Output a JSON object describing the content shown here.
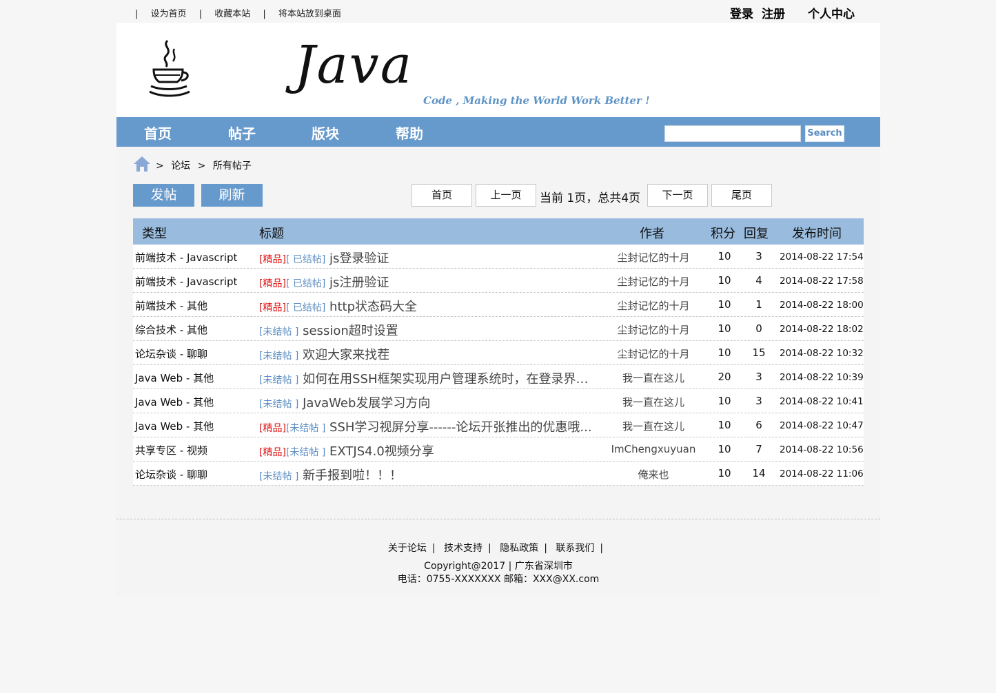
{
  "topbar": {
    "links": [
      "设为首页",
      "收藏本站",
      "将本站放到桌面"
    ],
    "separator": "|",
    "login": "登录",
    "register": "注册",
    "profile": "个人中心"
  },
  "banner": {
    "logo_text": "Java",
    "slogan": "Code , Making the World Work Better !"
  },
  "nav": {
    "items": [
      "首页",
      "帖子",
      "版块",
      "帮助"
    ],
    "search_placeholder": "",
    "search_button": "Search"
  },
  "breadcrumb": {
    "sep": ">",
    "items": [
      "论坛",
      "所有帖子"
    ]
  },
  "actions": {
    "post": "发帖",
    "refresh": "刷新"
  },
  "pager": {
    "first": "首页",
    "prev": "上一页",
    "info": "当前 1页，总共4页",
    "next": "下一页",
    "last": "尾页"
  },
  "table": {
    "headers": {
      "type": "类型",
      "title": "标题",
      "author": "作者",
      "score": "积分",
      "reply": "回复",
      "time": "发布时间"
    },
    "rows": [
      {
        "type": "前端技术 - Javascript",
        "good": "[精品]",
        "tag": "[ 已结帖]",
        "title": "js登录验证",
        "author": "尘封记忆的十月",
        "score": "10",
        "reply": "3",
        "time": "2014-08-22 17:54"
      },
      {
        "type": "前端技术 - Javascript",
        "good": "[精品]",
        "tag": "[ 已结帖]",
        "title": "js注册验证",
        "author": "尘封记忆的十月",
        "score": "10",
        "reply": "4",
        "time": "2014-08-22 17:58"
      },
      {
        "type": "前端技术 - 其他",
        "good": "[精品]",
        "tag": "[ 已结帖]",
        "title": "http状态码大全",
        "author": "尘封记忆的十月",
        "score": "10",
        "reply": "1",
        "time": "2014-08-22 18:00"
      },
      {
        "type": "综合技术 - 其他",
        "good": "",
        "tag": "[未结帖 ]",
        "title": "session超时设置",
        "author": "尘封记忆的十月",
        "score": "10",
        "reply": "0",
        "time": "2014-08-22 18:02"
      },
      {
        "type": "论坛杂谈 - 聊聊",
        "good": "",
        "tag": "[未结帖 ]",
        "title": "欢迎大家来找茬",
        "author": "尘封记忆的十月",
        "score": "10",
        "reply": "15",
        "time": "2014-08-22 10:32"
      },
      {
        "type": "Java Web - 其他",
        "good": "",
        "tag": "[未结帖 ]",
        "title": "如何在用SSH框架实现用户管理系统时，在登录界面...",
        "author": "我一直在这儿",
        "score": "20",
        "reply": "3",
        "time": "2014-08-22 10:39"
      },
      {
        "type": "Java Web - 其他",
        "good": "",
        "tag": "[未结帖 ]",
        "title": "JavaWeb发展学习方向",
        "author": "我一直在这儿",
        "score": "10",
        "reply": "3",
        "time": "2014-08-22 10:41"
      },
      {
        "type": "Java Web - 其他",
        "good": "[精品]",
        "tag": "[未结帖 ]",
        "title": "SSH学习视屏分享------论坛开张推出的优惠哦...",
        "author": "我一直在这儿",
        "score": "10",
        "reply": "6",
        "time": "2014-08-22 10:47"
      },
      {
        "type": "共享专区 - 视频",
        "good": "[精品]",
        "tag": "[未结帖 ]",
        "title": "EXTJS4.0视频分享",
        "author": "ImChengxuyuan",
        "score": "10",
        "reply": "7",
        "time": "2014-08-22 10:56"
      },
      {
        "type": "论坛杂谈 - 聊聊",
        "good": "",
        "tag": "[未结帖 ]",
        "title": "新手报到啦！！！",
        "author": "俺来也",
        "score": "10",
        "reply": "14",
        "time": "2014-08-22 11:06"
      }
    ]
  },
  "footer": {
    "links": [
      "关于论坛",
      "技术支持",
      "隐私政策",
      "联系我们"
    ],
    "separator": "|",
    "copyright": "Copyright@2017 | 广东省深圳市",
    "contact": "电话：0755-XXXXXXX 邮箱：XXX@XX.com"
  },
  "colors": {
    "nav_bg": "#6699cc",
    "table_header_bg": "#99bbdd",
    "good_tag": "#e01010",
    "status_tag": "#5b8dc2"
  }
}
